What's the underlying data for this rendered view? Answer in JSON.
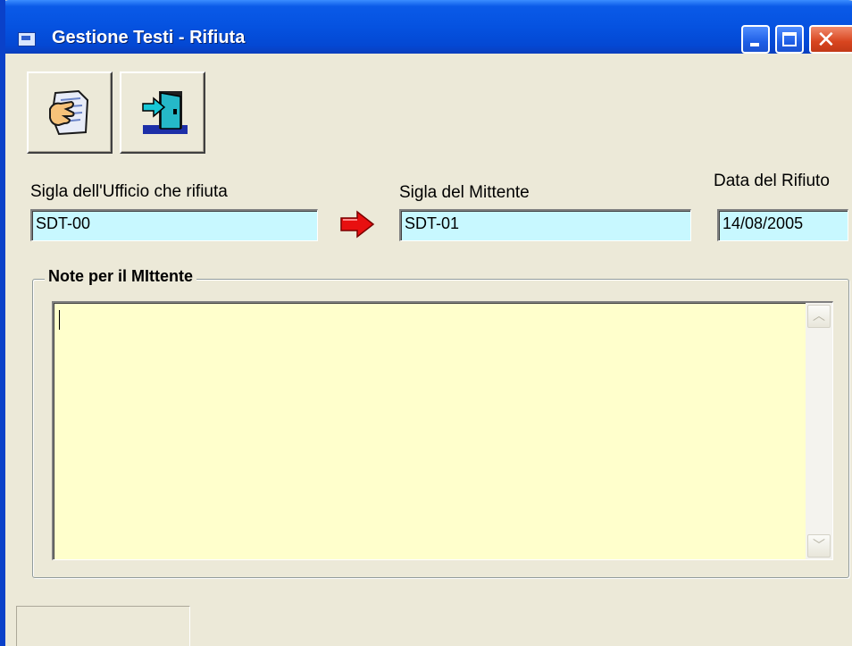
{
  "window": {
    "title": "Gestione Testi - Rifiuta",
    "title_icon": "app-window-icon",
    "controls": {
      "minimize_icon": "minimize-icon",
      "maximize_icon": "maximize-icon",
      "close_icon": "close-icon",
      "close_glyph": "✕"
    }
  },
  "toolbar": {
    "reject_icon": "reject-document-icon",
    "exit_icon": "exit-door-icon"
  },
  "form": {
    "office_label": "Sigla dell'Ufficio che rifiuta",
    "office_value": "SDT-00",
    "sender_label": "Sigla del Mittente",
    "sender_value": "SDT-01",
    "date_label": "Data del Rifiuto",
    "date_value": "14/08/2005",
    "arrow_icon": "red-arrow-right-icon"
  },
  "notes": {
    "group_title": "Note per il MIttente",
    "value": "",
    "scroll_up_glyph": "︿",
    "scroll_down_glyph": "﹀"
  },
  "colors": {
    "titlebar": "#0552e0",
    "field_background": "#c8f8ff",
    "notes_background": "#ffffcc",
    "arrow": "#e81010",
    "window_background": "#ece9d8"
  }
}
